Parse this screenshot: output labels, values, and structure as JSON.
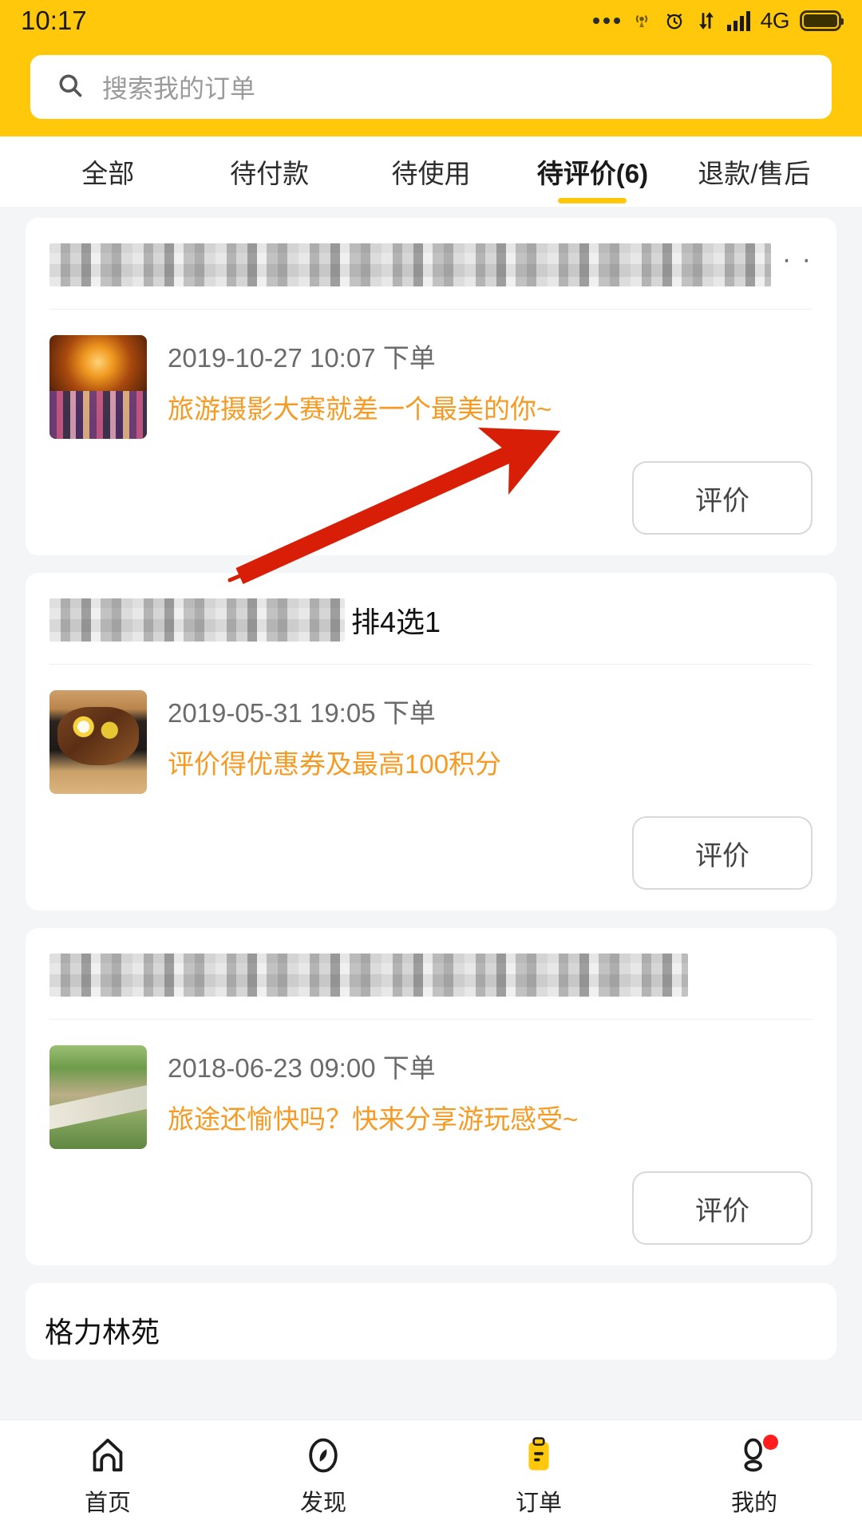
{
  "status_bar": {
    "time": "10:17",
    "network": "4G",
    "icons": [
      "dots-icon",
      "hotspot-icon",
      "alarm-clock-icon",
      "data-transfer-icon",
      "signal-bars-icon",
      "battery-icon"
    ]
  },
  "search": {
    "placeholder": "搜索我的订单",
    "icon": "search-icon"
  },
  "tabs": [
    {
      "label": "全部",
      "active": false
    },
    {
      "label": "待付款",
      "active": false
    },
    {
      "label": "待使用",
      "active": false
    },
    {
      "label": "待评价(6)",
      "active": true
    },
    {
      "label": "退款/售后",
      "active": false
    }
  ],
  "orders": [
    {
      "title_blurred": true,
      "title_overlay": "",
      "more_dots": "· ·",
      "date": "2019-10-27 10:07 下单",
      "promo": "旅游摄影大赛就差一个最美的你~",
      "action_label": "评价",
      "thumb": "carousel-night-photo"
    },
    {
      "title_blurred": true,
      "title_overlay": "排4选1",
      "more_dots": "",
      "date": "2019-05-31 19:05 下单",
      "promo": "评价得优惠券及最高100积分",
      "action_label": "评价",
      "thumb": "steak-plate-photo"
    },
    {
      "title_blurred": true,
      "title_overlay": "",
      "more_dots": "",
      "date": "2018-06-23 09:00 下单",
      "promo": "旅途还愉快吗？快来分享游玩感受~",
      "action_label": "评价",
      "thumb": "mountain-trail-photo"
    },
    {
      "title_blurred": false,
      "title_overlay": "格力林苑",
      "partial": true
    }
  ],
  "bottom_nav": [
    {
      "label": "首页",
      "icon": "home-icon",
      "active": false,
      "badge": false
    },
    {
      "label": "发现",
      "icon": "compass-icon",
      "active": false,
      "badge": false
    },
    {
      "label": "订单",
      "icon": "clipboard-icon",
      "active": true,
      "badge": false
    },
    {
      "label": "我的",
      "icon": "person-icon",
      "active": false,
      "badge": true
    }
  ],
  "colors": {
    "brand_yellow": "#FFC80A",
    "promo_orange": "#F59A23",
    "annotation_red": "#D81E06",
    "page_bg": "#F4F5F7",
    "badge_red": "#FF1D1D"
  }
}
